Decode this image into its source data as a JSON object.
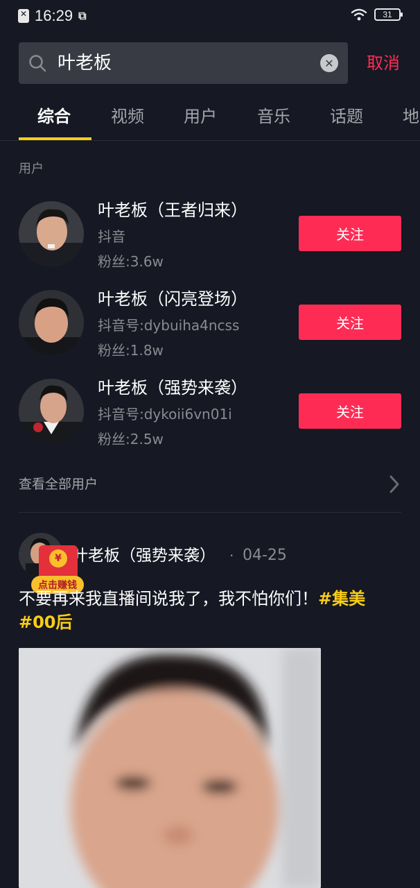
{
  "status_bar": {
    "time": "16:29",
    "battery": "31"
  },
  "search": {
    "query": "叶老板",
    "cancel_label": "取消"
  },
  "tabs": [
    {
      "label": "综合",
      "active": true
    },
    {
      "label": "视频",
      "active": false
    },
    {
      "label": "用户",
      "active": false
    },
    {
      "label": "音乐",
      "active": false
    },
    {
      "label": "话题",
      "active": false
    },
    {
      "label": "地",
      "active": false
    }
  ],
  "users_section": {
    "label": "用户",
    "users": [
      {
        "name": "叶老板（王者归来）",
        "id": "抖音",
        "fans": "粉丝:3.6w",
        "follow_label": "关注"
      },
      {
        "name": "叶老板（闪亮登场）",
        "id": "抖音号:dybuiha4ncss",
        "fans": "粉丝:1.8w",
        "follow_label": "关注"
      },
      {
        "name": "叶老板（强势来袭）",
        "id": "抖音号:dykoii6vn01i",
        "fans": "粉丝:2.5w",
        "follow_label": "关注"
      }
    ],
    "view_all_label": "查看全部用户"
  },
  "post": {
    "author": "叶老板（强势来袭）",
    "separator": "·",
    "date": "04-25",
    "text": "不要再来我直播间说我了，我不怕你们！",
    "hashtag_1": "#集美",
    "hashtag_2": "#00后"
  },
  "red_envelope": {
    "coin": "¥",
    "label": "点击赚钱"
  },
  "colors": {
    "background": "#161823",
    "accent": "#fe2c55",
    "tab_underline": "#face15",
    "hashtag": "#face15"
  }
}
